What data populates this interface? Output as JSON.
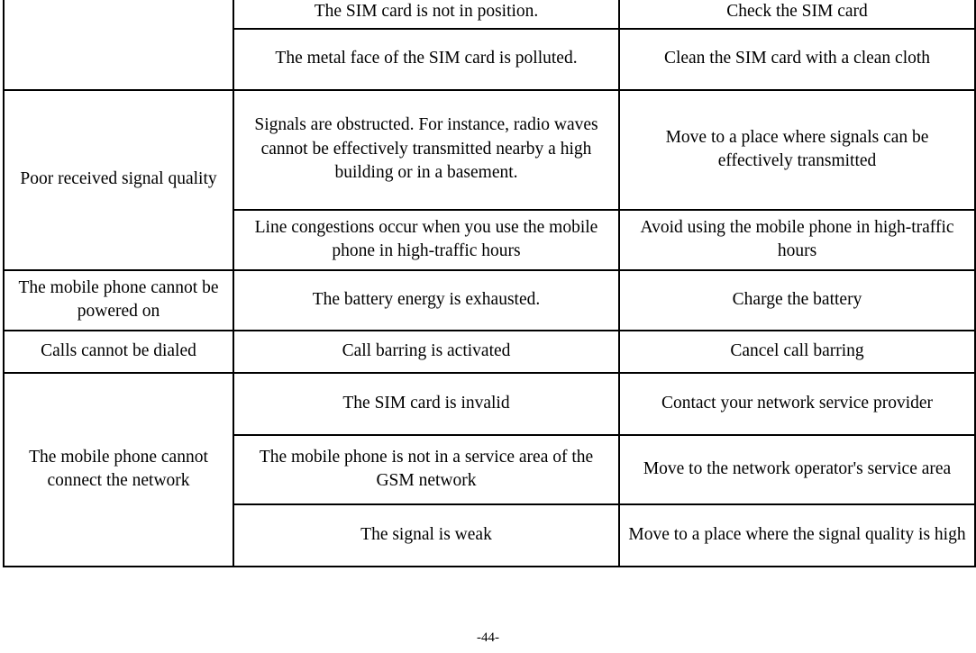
{
  "document": {
    "page_footer": "-44-",
    "type": "troubleshooting-table"
  },
  "table": {
    "columns": 3,
    "rows": [
      {
        "symptom": "",
        "symptom_rowspan": 2,
        "symptom_clipped": true,
        "cause": "The SIM card is not in position.",
        "solution": "Check the SIM card"
      },
      {
        "cause": "The metal face of the SIM card is polluted.",
        "solution": "Clean the SIM card with a clean cloth"
      },
      {
        "symptom": "Poor received signal quality",
        "symptom_rowspan": 2,
        "cause": "Signals are obstructed. For instance, radio waves cannot be effectively transmitted nearby a high building or in a basement.",
        "solution": "Move to a place where signals can be effectively transmitted"
      },
      {
        "cause": "Line congestions occur when you use the mobile phone in high-traffic hours",
        "solution": "Avoid using the mobile phone in high-traffic hours"
      },
      {
        "symptom": "The mobile phone cannot be powered on",
        "symptom_rowspan": 1,
        "cause": "The battery energy is exhausted.",
        "solution": "Charge the battery"
      },
      {
        "symptom": "Calls cannot be dialed",
        "symptom_rowspan": 1,
        "cause": "Call barring is activated",
        "solution": "Cancel call barring"
      },
      {
        "symptom": "The mobile phone cannot connect the network",
        "symptom_rowspan": 3,
        "cause": "The SIM card is invalid",
        "solution": "Contact your network service provider"
      },
      {
        "cause": "The mobile phone is not in a service area of the GSM network",
        "solution": "Move to the network operator's service area"
      },
      {
        "cause": "The signal is weak",
        "solution": "Move to a place where the signal quality is high"
      }
    ]
  }
}
